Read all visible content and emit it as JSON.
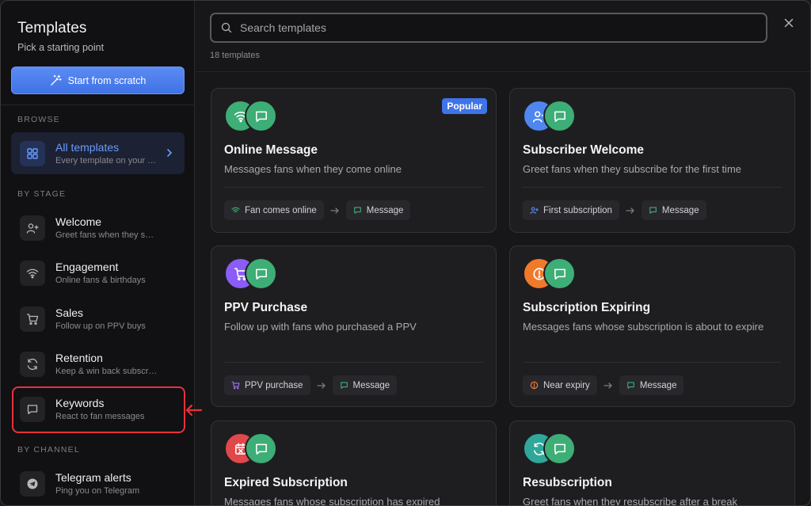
{
  "sidebar": {
    "title": "Templates",
    "subtitle": "Pick a starting point",
    "scratch_label": "Start from scratch",
    "browse_label": "BROWSE",
    "stage_label": "BY STAGE",
    "channel_label": "BY CHANNEL",
    "all": {
      "label": "All templates",
      "desc": "Every template on your account"
    },
    "stages": [
      {
        "label": "Welcome",
        "desc": "Greet fans when they subscribe",
        "icon": "user-plus-icon"
      },
      {
        "label": "Engagement",
        "desc": "Online fans & birthdays",
        "icon": "wifi-icon"
      },
      {
        "label": "Sales",
        "desc": "Follow up on PPV buys",
        "icon": "cart-icon"
      },
      {
        "label": "Retention",
        "desc": "Keep & win back subscribers",
        "icon": "refresh-icon"
      },
      {
        "label": "Keywords",
        "desc": "React to fan messages",
        "icon": "message-icon"
      }
    ],
    "channels": [
      {
        "label": "Telegram alerts",
        "desc": "Ping you on Telegram",
        "icon": "telegram-icon"
      }
    ]
  },
  "search": {
    "placeholder": "Search templates",
    "value": ""
  },
  "count_text": "18 templates",
  "cards": [
    {
      "title": "Online Message",
      "desc": "Messages fans when they come online",
      "badge": "Popular",
      "trigger": "Fan comes online",
      "action": "Message",
      "trigger_icon": "wifi-icon",
      "trigger_color": "#3dae76"
    },
    {
      "title": "Subscriber Welcome",
      "desc": "Greet fans when they subscribe for the first time",
      "trigger": "First subscription",
      "action": "Message",
      "trigger_icon": "user-plus-icon",
      "trigger_color": "#4f86f0"
    },
    {
      "title": "PPV Purchase",
      "desc": "Follow up with fans who purchased a PPV",
      "trigger": "PPV purchase",
      "action": "Message",
      "trigger_icon": "cart-icon",
      "trigger_color": "#8b5cf6"
    },
    {
      "title": "Subscription Expiring",
      "desc": "Messages fans whose subscription is about to expire",
      "trigger": "Near expiry",
      "action": "Message",
      "trigger_icon": "alert-icon",
      "trigger_color": "#f07a2a"
    },
    {
      "title": "Expired Subscription",
      "desc": "Messages fans whose subscription has expired",
      "trigger_icon": "calendar-x-icon",
      "trigger_color": "#e0484b"
    },
    {
      "title": "Resubscription",
      "desc": "Greet fans when they resubscribe after a break",
      "trigger_icon": "refresh-icon",
      "trigger_color": "#2fa89a"
    }
  ],
  "colors": {
    "accent": "#4f86f0",
    "message_green": "#3dae76",
    "highlight_red": "#e8313a"
  }
}
